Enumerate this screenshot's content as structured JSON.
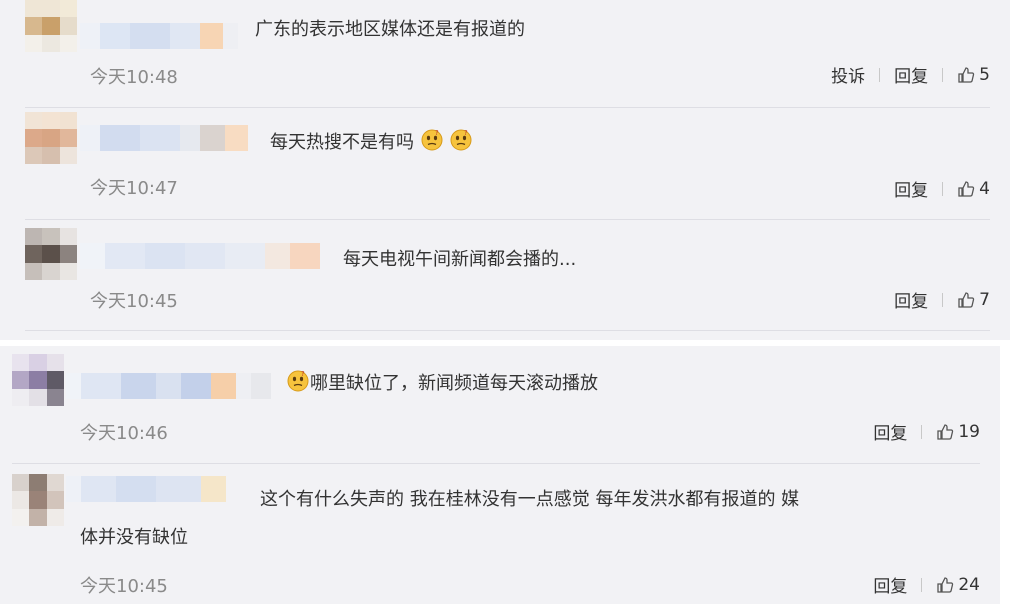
{
  "comments": [
    {
      "text": "广东的表示地区媒体还是有报道的",
      "time": "今天10:48",
      "report": "投诉",
      "reply": "回复",
      "likes": "5"
    },
    {
      "text": "每天热搜不是有吗",
      "time": "今天10:47",
      "reply": "回复",
      "likes": "4"
    },
    {
      "text": "每天电视午间新闻都会播的...",
      "time": "今天10:45",
      "reply": "回复",
      "likes": "7"
    },
    {
      "text": "哪里缺位了，新闻频道每天滚动播放",
      "time": "今天10:46",
      "reply": "回复",
      "likes": "19"
    },
    {
      "text_line1": "这个有什么失声的 我在桂林没有一点感觉 每年发洪水都有报道的 媒",
      "text_line2": "体并没有缺位",
      "time": "今天10:45",
      "reply": "回复",
      "likes": "24"
    }
  ],
  "colors": {
    "panel_bg": "#f2f2f5",
    "text": "#333333",
    "time": "#8a8a8a",
    "divider": "#dedee4"
  },
  "icons": {
    "like": "thumbs-up-icon",
    "emoji": "confused-face-emoji"
  }
}
